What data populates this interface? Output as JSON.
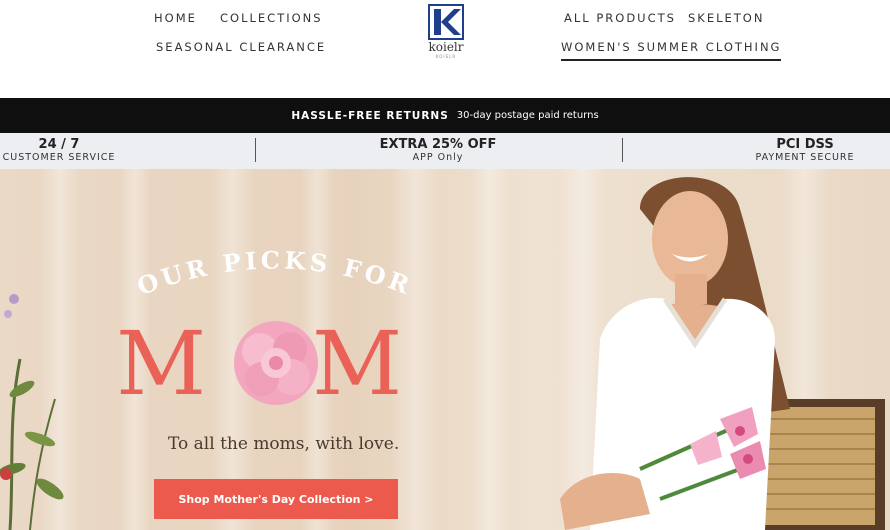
{
  "header": {
    "nav_left": {
      "home": "HOME",
      "collections": "COLLECTIONS",
      "clearance": "SEASONAL CLEARANCE"
    },
    "nav_right": {
      "all_products": "ALL PRODUCTS",
      "skeleton": "SKELETON",
      "womens": "WOMEN'S SUMMER CLOTHING"
    },
    "logo": {
      "word": "koielr",
      "sub": "KOIELR"
    }
  },
  "announcement": {
    "strong": "HASSLE-FREE RETURNS",
    "text": "30-day postage paid returns"
  },
  "features": [
    {
      "title": "24 / 7",
      "subtitle": "CUSTOMER SERVICE"
    },
    {
      "title": "EXTRA 25% OFF",
      "subtitle": "APP Only"
    },
    {
      "title": "PCI DSS",
      "subtitle": "PAYMENT SECURE"
    }
  ],
  "hero": {
    "picks": "OUR PICKS FOR",
    "mom_left": "M",
    "mom_right": "M",
    "tagline": "To all the moms, with love.",
    "cta": "Shop Mother's Day Collection >"
  },
  "colors": {
    "accent": "#ea6157",
    "cta": "#ec5a4d",
    "announce_bg": "#0f0f0f",
    "features_bg": "#eceef2",
    "logo_blue": "#1f3f8c"
  }
}
